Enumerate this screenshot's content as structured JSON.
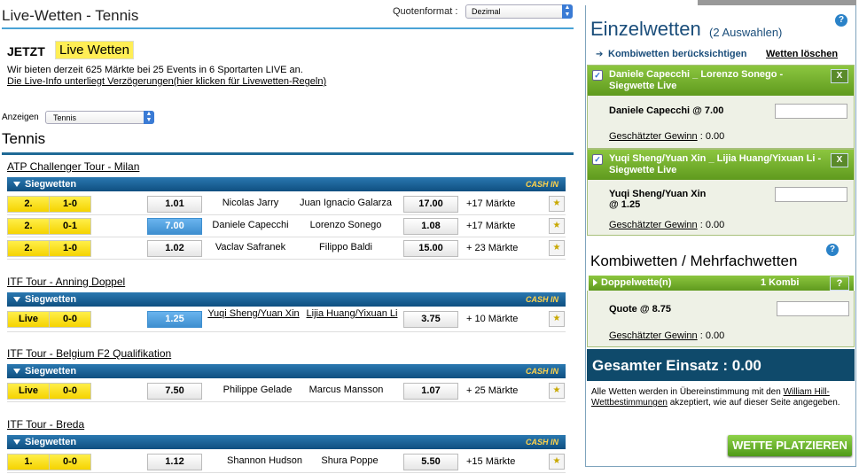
{
  "header": {
    "page_title": "Live-Wetten - Tennis",
    "odds_format_label": "Quotenformat :",
    "odds_format_value": "Dezimal"
  },
  "intro": {
    "jetzt": "JETZT",
    "live_badge": "Live Wetten",
    "info_line": "Wir bieten derzeit 625 Märkte bei 25 Events in 6 Sportarten LIVE an.",
    "info_link": "Die Live-Info unterliegt Verzögerungen(hier klicken für Livewetten-Regeln)"
  },
  "filter": {
    "label": "Anzeigen",
    "value": "Tennis"
  },
  "sport_title": "Tennis",
  "market_label": "Siegwetten",
  "cash_in": "CASH IN",
  "tournaments": [
    {
      "name": "ATP Challenger Tour - Milan",
      "matches": [
        {
          "set": "2.",
          "score": "1-0",
          "odd1": "1.01",
          "player1": "Nicolas Jarry",
          "player2": "Juan Ignacio Galarza",
          "odd2": "17.00",
          "markets": "+17 Märkte"
        },
        {
          "set": "2.",
          "score": "0-1",
          "odd1": "7.00",
          "player1": "Daniele Capecchi",
          "player2": "Lorenzo Sonego",
          "odd2": "1.08",
          "markets": "+17 Märkte"
        },
        {
          "set": "2.",
          "score": "1-0",
          "odd1": "1.02",
          "player1": "Vaclav Safranek",
          "player2": "Filippo Baldi",
          "odd2": "15.00",
          "markets": "+ 23 Märkte"
        }
      ]
    },
    {
      "name": "ITF Tour - Anning Doppel",
      "matches": [
        {
          "set": "Live",
          "score": "0-0",
          "odd1": "1.25",
          "player1": "Yuqi Sheng/Yuan Xin",
          "player2": "Lijia Huang/Yixuan Li",
          "odd2": "3.75",
          "markets": "+ 10 Märkte"
        }
      ]
    },
    {
      "name": "ITF Tour - Belgium F2 Qualifikation",
      "matches": [
        {
          "set": "Live",
          "score": "0-0",
          "odd1": "7.50",
          "player1": "Philippe Gelade",
          "player2": "Marcus Mansson",
          "odd2": "1.07",
          "markets": "+ 25 Märkte"
        }
      ]
    },
    {
      "name": "ITF Tour - Breda",
      "matches": [
        {
          "set": "1.",
          "score": "0-0",
          "odd1": "1.12",
          "player1": "Shannon Hudson",
          "player2": "Shura Poppe",
          "odd2": "5.50",
          "markets": "+15 Märkte"
        }
      ]
    }
  ],
  "betslip": {
    "title": "Einzelwetten",
    "count": "(2 Auswahlen)",
    "kombi_toggle": "Kombiwetten berücksichtigen",
    "clear": "Wetten löschen",
    "bets": [
      {
        "head": "Daniele Capecchi _ Lorenzo Sonego - Siegwette Live",
        "selection": "Daniele Capecchi @ 7.00",
        "gewinn_label": "Geschätzter Gewinn",
        "gewinn_value": ": 0.00"
      },
      {
        "head": "Yuqi Sheng/Yuan Xin _ Lijia Huang/Yixuan Li - Siegwette Live",
        "selection_line1": "Yuqi Sheng/Yuan Xin",
        "selection_line2": "@ 1.25",
        "gewinn_label": "Geschätzter Gewinn",
        "gewinn_value": ": 0.00"
      }
    ],
    "kombi_title": "Kombiwetten / Mehrfachwetten",
    "doppel_label": "Doppelwette(n)",
    "doppel_count": "1 Kombi",
    "doppel_help": "?",
    "quote": "Quote @ 8.75",
    "kombi_gewinn_label": "Geschätzter Gewinn",
    "kombi_gewinn_value": ": 0.00",
    "einsatz": "Gesamter Einsatz :  0.00",
    "terms_pre": "Alle Wetten werden in Übereinstimmung mit den ",
    "terms_link": "William Hill- Wettbestimmungen",
    "terms_post": " akzeptiert, wie auf dieser Seite angegeben.",
    "place_button": "WETTE PLATZIEREN",
    "close": "X",
    "help": "?"
  },
  "colors": {
    "accent_blue": "#1f6a96",
    "live_yellow": "#ffee55",
    "slip_green": "#6aa82a",
    "einsatz_bg": "#0f4a6b"
  }
}
